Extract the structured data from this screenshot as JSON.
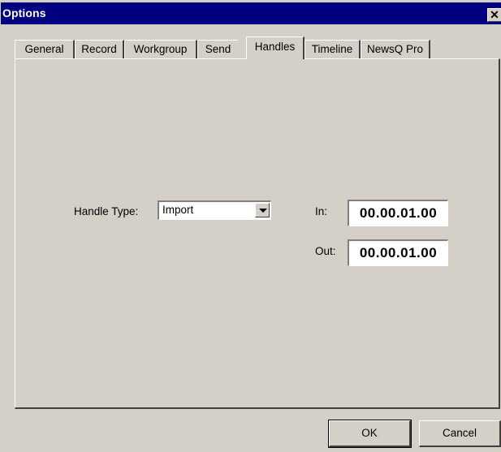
{
  "window": {
    "title": "Options",
    "close_glyph": "✕"
  },
  "tabs": [
    {
      "label": "General"
    },
    {
      "label": "Record"
    },
    {
      "label": "Workgroup"
    },
    {
      "label": "Send"
    },
    {
      "label": "Handles",
      "active": true
    },
    {
      "label": "Timeline"
    },
    {
      "label": "NewsQ Pro"
    }
  ],
  "handles": {
    "handle_type_label": "Handle Type:",
    "handle_type_value": "Import",
    "in_label": "In:",
    "in_value": "00.00.01.00",
    "out_label": "Out:",
    "out_value": "00.00.01.00"
  },
  "buttons": {
    "ok": "OK",
    "cancel": "Cancel"
  },
  "icons": {
    "close": "close-icon",
    "dropdown": "chevron-down-icon"
  }
}
